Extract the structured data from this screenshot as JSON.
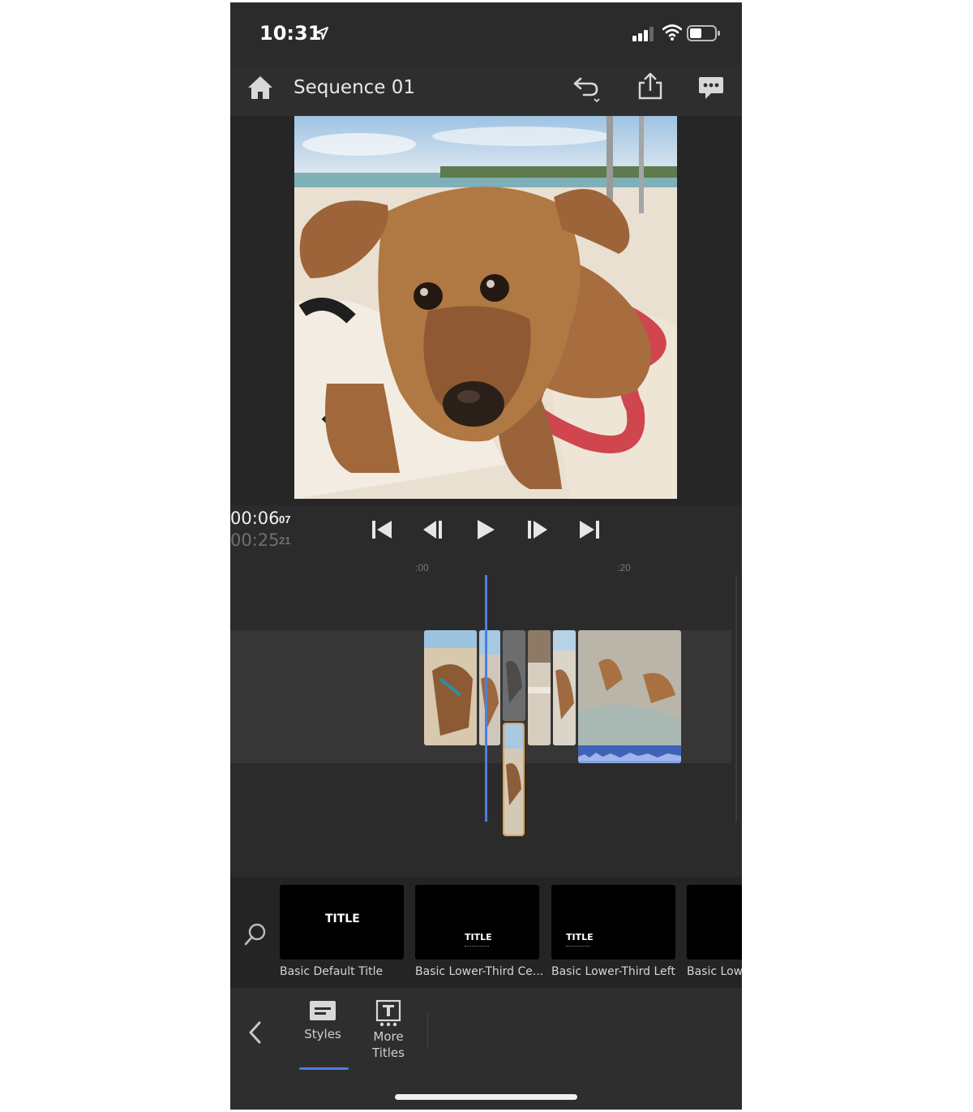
{
  "status_bar": {
    "time": "10:31"
  },
  "header": {
    "title": "Sequence 01"
  },
  "icons": {
    "home": "home-icon",
    "undo": "undo-icon",
    "share": "share-icon",
    "comment": "comment-icon",
    "search": "search-icon",
    "back": "chevron-left-icon"
  },
  "transport": {
    "current_time": "00:06",
    "current_frames": "07",
    "duration_time": "00:25",
    "duration_frames": "21"
  },
  "timeline": {
    "ruler_labels": [
      ":00",
      ":20"
    ]
  },
  "titles": [
    {
      "caption": "Basic Default Title",
      "card_text": "TITLE"
    },
    {
      "caption": "Basic Lower-Third Ce...",
      "card_text": "TITLE"
    },
    {
      "caption": "Basic Lower-Third Left",
      "card_text": "TITLE"
    },
    {
      "caption": "Basic Lower",
      "card_text": ""
    }
  ],
  "tabs": [
    {
      "label": "Styles",
      "active": true
    },
    {
      "label": "More Titles",
      "active": false
    }
  ],
  "colors": {
    "accent": "#4a7fe0",
    "selection": "#e8a043",
    "background": "#2b2b2b"
  }
}
